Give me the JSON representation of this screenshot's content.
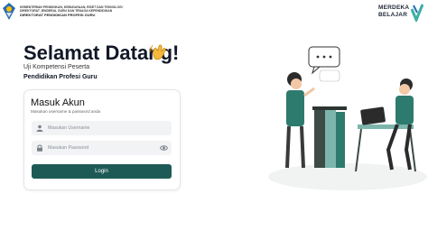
{
  "header": {
    "institution_line1": "KEMENTERIAN PENDIDIKAN, KEBUDAYAAN, RISET DAN TEKNOLOGI",
    "institution_line2": "DIREKTORAT JENDERAL GURU DAN TENAGA KEPENDIDIKAN",
    "institution_line3": "DIREKTORAT PENDIDIKAN PROFESI GURU",
    "merdeka_line1": "MERDEKA",
    "merdeka_line2": "BELAJAR"
  },
  "hero": {
    "title": "Selamat Datang!",
    "subtitle": "Uji Kompetensi Peserta",
    "program": "Pendidikan Profesi Guru"
  },
  "login": {
    "title": "Masuk Akun",
    "instruction": "Masukan username & password anda",
    "username_placeholder": "Masukan Username",
    "password_placeholder": "Masukan Password",
    "submit_label": "Login"
  },
  "colors": {
    "primary": "#1e5a55",
    "logo_blue": "#2a6cb3",
    "accent_teal": "#3ab0a4"
  },
  "icons": [
    "tut-wuri-logo-icon",
    "merdeka-belajar-check-icon",
    "waving-hand-icon",
    "user-icon",
    "lock-icon",
    "eye-icon"
  ]
}
